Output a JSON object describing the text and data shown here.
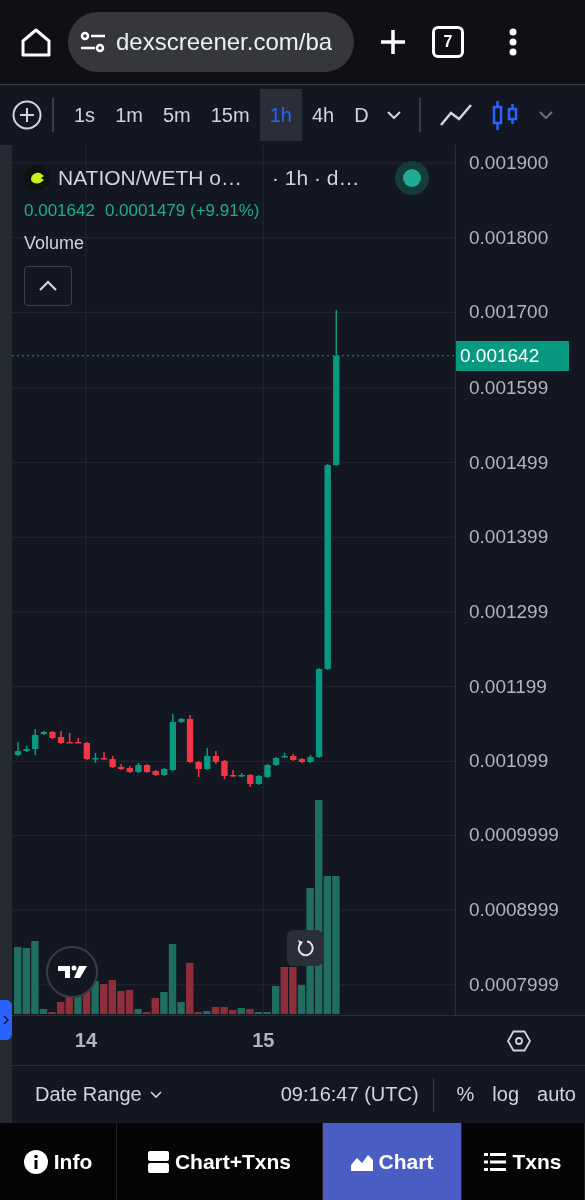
{
  "browser": {
    "url": "dexscreener.com/ba",
    "tab_count": "7"
  },
  "toolbar": {
    "intervals": [
      {
        "label": "1s",
        "selected": false
      },
      {
        "label": "1m",
        "selected": false
      },
      {
        "label": "5m",
        "selected": false
      },
      {
        "label": "15m",
        "selected": false
      },
      {
        "label": "1h",
        "selected": true
      },
      {
        "label": "4h",
        "selected": false
      },
      {
        "label": "D",
        "selected": false
      }
    ],
    "chart_types": [
      {
        "kind": "line",
        "selected": false
      },
      {
        "kind": "candles",
        "selected": true
      }
    ]
  },
  "chart": {
    "title": "NATION/WETH o…",
    "subtitle": "· 1h · d…",
    "price": "0.001642",
    "change": "0.0001479 (+9.91%)",
    "indicator": "Volume",
    "current_price": "0.001642",
    "chart_data": {
      "type": "candlestick",
      "x": [
        13.6168,
        13.6653,
        13.7138,
        13.7623,
        13.8108,
        13.8593,
        13.9078,
        13.9563,
        14.0048,
        14.0533,
        14.1018,
        14.1503,
        14.1988,
        14.2473,
        14.2958,
        14.3443,
        14.3928,
        14.4413,
        14.4898,
        14.5383,
        14.5868,
        14.6353,
        14.6838,
        14.7323,
        14.7808,
        14.8293,
        14.8778,
        14.9263,
        14.9748,
        15.0233,
        15.0718,
        15.1203,
        15.1688,
        15.2173,
        15.2658,
        15.3143,
        15.3628,
        15.4113
      ],
      "ohlc": [
        [
          0.0011075,
          0.0011249,
          0.0011062,
          0.0011128
        ],
        [
          0.0011128,
          0.0011195,
          0.0011115,
          0.0011155
        ],
        [
          0.0011155,
          0.0011423,
          0.0011075,
          0.0011343
        ],
        [
          0.0011356,
          0.0011396,
          0.0011343,
          0.0011383
        ],
        [
          0.0011383,
          0.0011396,
          0.0011289,
          0.0011303
        ],
        [
          0.0011316,
          0.0011396,
          0.0011222,
          0.0011236
        ],
        [
          0.0011249,
          0.0011369,
          0.0011236,
          0.0011236
        ],
        [
          0.0011249,
          0.0011303,
          0.0011236,
          0.0011236
        ],
        [
          0.0011236,
          0.0011249,
          0.0011008,
          0.0011021
        ],
        [
          0.0011021,
          0.0011102,
          0.0010968,
          0.0011035
        ],
        [
          0.0011035,
          0.0011115,
          0.0011008,
          0.0011021
        ],
        [
          0.0011021,
          0.0011062,
          0.0010901,
          0.0010914
        ],
        [
          0.0010914,
          0.0010954,
          0.0010874,
          0.0010887
        ],
        [
          0.0010901,
          0.0010928,
          0.0010834,
          0.0010847
        ],
        [
          0.0010847,
          0.0010968,
          0.0010834,
          0.0010941
        ],
        [
          0.0010941,
          0.0010954,
          0.0010834,
          0.0010847
        ],
        [
          0.0010861,
          0.0010874,
          0.0010794,
          0.0010807
        ],
        [
          0.0010807,
          0.0010901,
          0.0010794,
          0.0010887
        ],
        [
          0.0010874,
          0.0011624,
          0.0010861,
          0.0011517
        ],
        [
          0.0011517,
          0.0011571,
          0.0011503,
          0.0011557
        ],
        [
          0.0011557,
          0.0011611,
          0.0010968,
          0.0010981
        ],
        [
          0.0010981,
          0.0010995,
          0.001078,
          0.0010887
        ],
        [
          0.0010887,
          0.0011168,
          0.0010874,
          0.0011062
        ],
        [
          0.0011062,
          0.0011128,
          0.0010954,
          0.0010981
        ],
        [
          0.0010995,
          0.0011008,
          0.0010753,
          0.0010794
        ],
        [
          0.0010807,
          0.0010874,
          0.001078,
          0.0010794
        ],
        [
          0.0010794,
          0.0010834,
          0.001078,
          0.0010807
        ],
        [
          0.0010807,
          0.001082,
          0.0010646,
          0.0010687
        ],
        [
          0.0010687,
          0.0010807,
          0.0010673,
          0.0010794
        ],
        [
          0.001078,
          0.0010954,
          0.0010767,
          0.0010941
        ],
        [
          0.0010941,
          0.0011048,
          0.0010928,
          0.0011035
        ],
        [
          0.0011048,
          0.0011102,
          0.0011035,
          0.0011062
        ],
        [
          0.0011062,
          0.0011088,
          0.0010995,
          0.0011008
        ],
        [
          0.0011021,
          0.0011035,
          0.0010968,
          0.0010981
        ],
        [
          0.0010981,
          0.0011075,
          0.0010968,
          0.0011048
        ],
        [
          0.0011048,
          0.0012239,
          0.0011035,
          0.0012226
        ],
        [
          0.0012226,
          0.001497,
          0.0012213,
          0.0014957
        ],
        [
          0.0014957,
          0.0017032,
          0.0014943,
          0.001642
        ]
      ],
      "xlim": [
        13.5829,
        16.8136
      ],
      "ylim": [
        0.0007594,
        0.0019241
      ],
      "grid": true,
      "ref_lines": [
        {
          "axis": "y",
          "value": 0.001642
        }
      ],
      "xticks": [
        {
          "value": 14,
          "label": "14"
        },
        {
          "value": 15,
          "label": "15"
        }
      ],
      "yticks": [
        {
          "value": 0.0019,
          "label": "0.001900"
        },
        {
          "value": 0.0018,
          "label": "0.001800"
        },
        {
          "value": 0.0017,
          "label": "0.001700"
        },
        {
          "value": 0.001599,
          "label": "0.001599"
        },
        {
          "value": 0.001499,
          "label": "0.001499"
        },
        {
          "value": 0.001399,
          "label": "0.001399"
        },
        {
          "value": 0.001299,
          "label": "0.001299"
        },
        {
          "value": 0.001199,
          "label": "0.001199"
        },
        {
          "value": 0.001099,
          "label": "0.001099"
        },
        {
          "value": 0.0009999,
          "label": "0.0009999"
        },
        {
          "value": 0.0008999,
          "label": "0.0008999"
        },
        {
          "value": 0.0007999,
          "label": "0.0007999"
        }
      ]
    }
  },
  "footer": {
    "date_range": "Date Range",
    "time": "09:16:47 (UTC)",
    "options": [
      "%",
      "log",
      "auto"
    ]
  },
  "nav": [
    {
      "kind": "info",
      "label": "Info",
      "selected": false
    },
    {
      "kind": "split",
      "label": "Chart+Txns",
      "selected": false
    },
    {
      "kind": "chart",
      "label": "Chart",
      "selected": true
    },
    {
      "kind": "list",
      "label": "Txns",
      "selected": false
    }
  ]
}
